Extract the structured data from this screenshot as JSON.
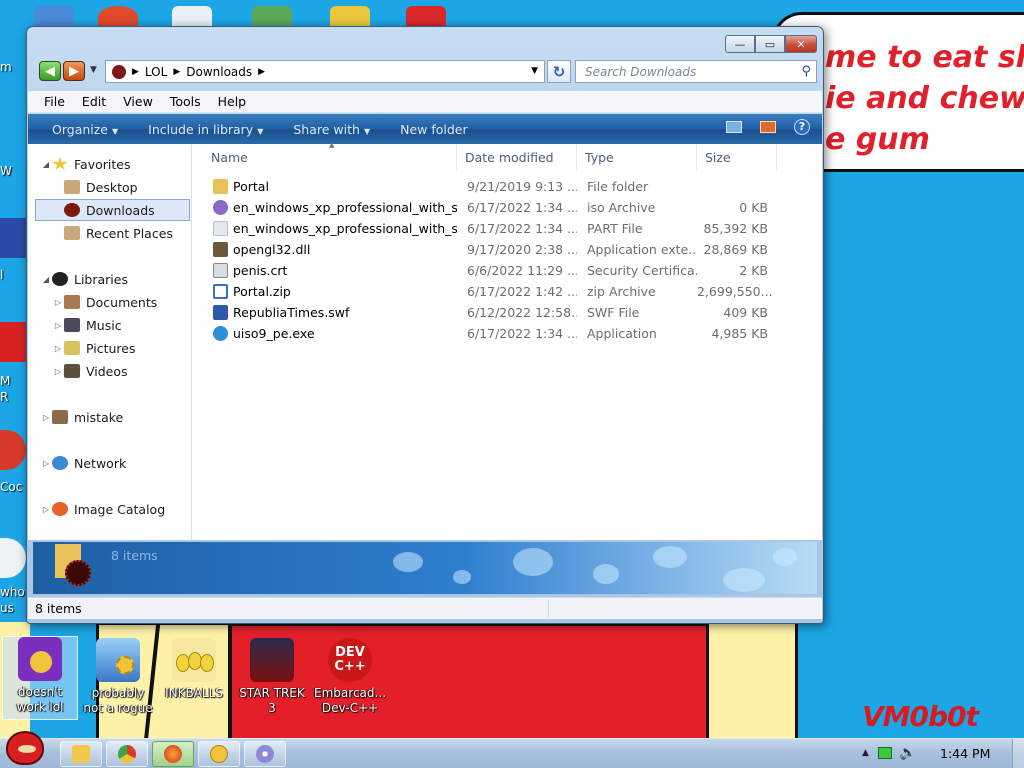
{
  "desktop": {
    "speech_lines": [
      "me to eat shit",
      "ie and chew",
      "e gum"
    ],
    "watermark": "VM0b0t",
    "left_stubs": [
      "m",
      "W",
      "l",
      "M",
      "R",
      "Coc",
      "who",
      "us"
    ],
    "icons": [
      {
        "label_line1": "doesn't",
        "label_line2": "work lol",
        "icon": "yahoo-messenger-icon",
        "color": "#7a2fbf",
        "selected": true
      },
      {
        "label_line1": "probably",
        "label_line2": "not a rogue",
        "icon": "gears-computer-icon",
        "color": "#4a8fd8"
      },
      {
        "label_line1": "INKBALLS",
        "label_line2": "",
        "icon": "inkballs-icon",
        "color": "#f2d33a"
      },
      {
        "label_line1": "STAR TREK",
        "label_line2": "3",
        "icon": "star-trek-icon",
        "color": "#7a1010"
      },
      {
        "label_line1": "Embarcad...",
        "label_line2": "Dev-C++",
        "icon": "dev-cpp-icon",
        "color": "#c81818"
      }
    ],
    "devcpp_logo": "DEV\nC++"
  },
  "window": {
    "caption": {
      "minimize": "—",
      "maximize": "▭",
      "close": "✕"
    },
    "address": {
      "crumbs": [
        "LOL",
        "Downloads"
      ]
    },
    "search": {
      "placeholder": "Search Downloads"
    },
    "menu": [
      "File",
      "Edit",
      "View",
      "Tools",
      "Help"
    ],
    "commands": [
      "Organize",
      "Include in library",
      "Share with",
      "New folder"
    ],
    "help_glyph": "?",
    "nav": {
      "favorites": "Favorites",
      "desktop": "Desktop",
      "downloads": "Downloads",
      "recent": "Recent Places",
      "libraries": "Libraries",
      "documents": "Documents",
      "music": "Music",
      "pictures": "Pictures",
      "videos": "Videos",
      "mistake": "mistake",
      "network": "Network",
      "image_catalog": "Image Catalog"
    },
    "columns": {
      "name": "Name",
      "date": "Date modified",
      "type": "Type",
      "size": "Size"
    },
    "files": [
      {
        "name": "Portal",
        "date": "9/21/2019 9:13 ...",
        "type": "File folder",
        "size": "",
        "icon": "folder-icon",
        "color": "#e8c258"
      },
      {
        "name": "en_windows_xp_professional_with_ser...",
        "date": "6/17/2022 1:34 ...",
        "type": "iso Archive",
        "size": "0 KB",
        "icon": "disc-icon",
        "color": "#8a6ac8"
      },
      {
        "name": "en_windows_xp_professional_with_ser...",
        "date": "6/17/2022 1:34 ...",
        "type": "PART File",
        "size": "85,392 KB",
        "icon": "blank-file-icon",
        "color": "#e4e8ee"
      },
      {
        "name": "opengl32.dll",
        "date": "9/17/2020 2:38 ...",
        "type": "Application exte...",
        "size": "28,869 KB",
        "icon": "dll-icon",
        "color": "#6a5a3a"
      },
      {
        "name": "penis.crt",
        "date": "6/6/2022 11:29 ...",
        "type": "Security Certifica...",
        "size": "2 KB",
        "icon": "certificate-icon",
        "color": "#d8dde4"
      },
      {
        "name": "Portal.zip",
        "date": "6/17/2022 1:42 ...",
        "type": "zip Archive",
        "size": "2,699,550...",
        "icon": "zip-icon",
        "color": "#3a6ad0"
      },
      {
        "name": "RepubliaTimes.swf",
        "date": "6/12/2022 12:58...",
        "type": "SWF File",
        "size": "409 KB",
        "icon": "swf-icon",
        "color": "#2a5aa8"
      },
      {
        "name": "uiso9_pe.exe",
        "date": "6/17/2022 1:34 ...",
        "type": "Application",
        "size": "4,985 KB",
        "icon": "exe-globe-icon",
        "color": "#2f8fd8"
      }
    ],
    "details": {
      "count": "8 items"
    },
    "status": {
      "text": "8 items"
    }
  },
  "taskbar": {
    "buttons": [
      {
        "icon": "explorer-icon",
        "color": "#f0c84a"
      },
      {
        "icon": "chrome-icon",
        "color": "#d83a2a"
      },
      {
        "icon": "firefox-icon",
        "color": "#e8621a",
        "active": true
      },
      {
        "icon": "smiley-icon",
        "color": "#f2c23a"
      },
      {
        "icon": "disc-app-icon",
        "color": "#8a8ad8"
      }
    ],
    "clock": "1:44 PM",
    "tray_up": "▲"
  }
}
